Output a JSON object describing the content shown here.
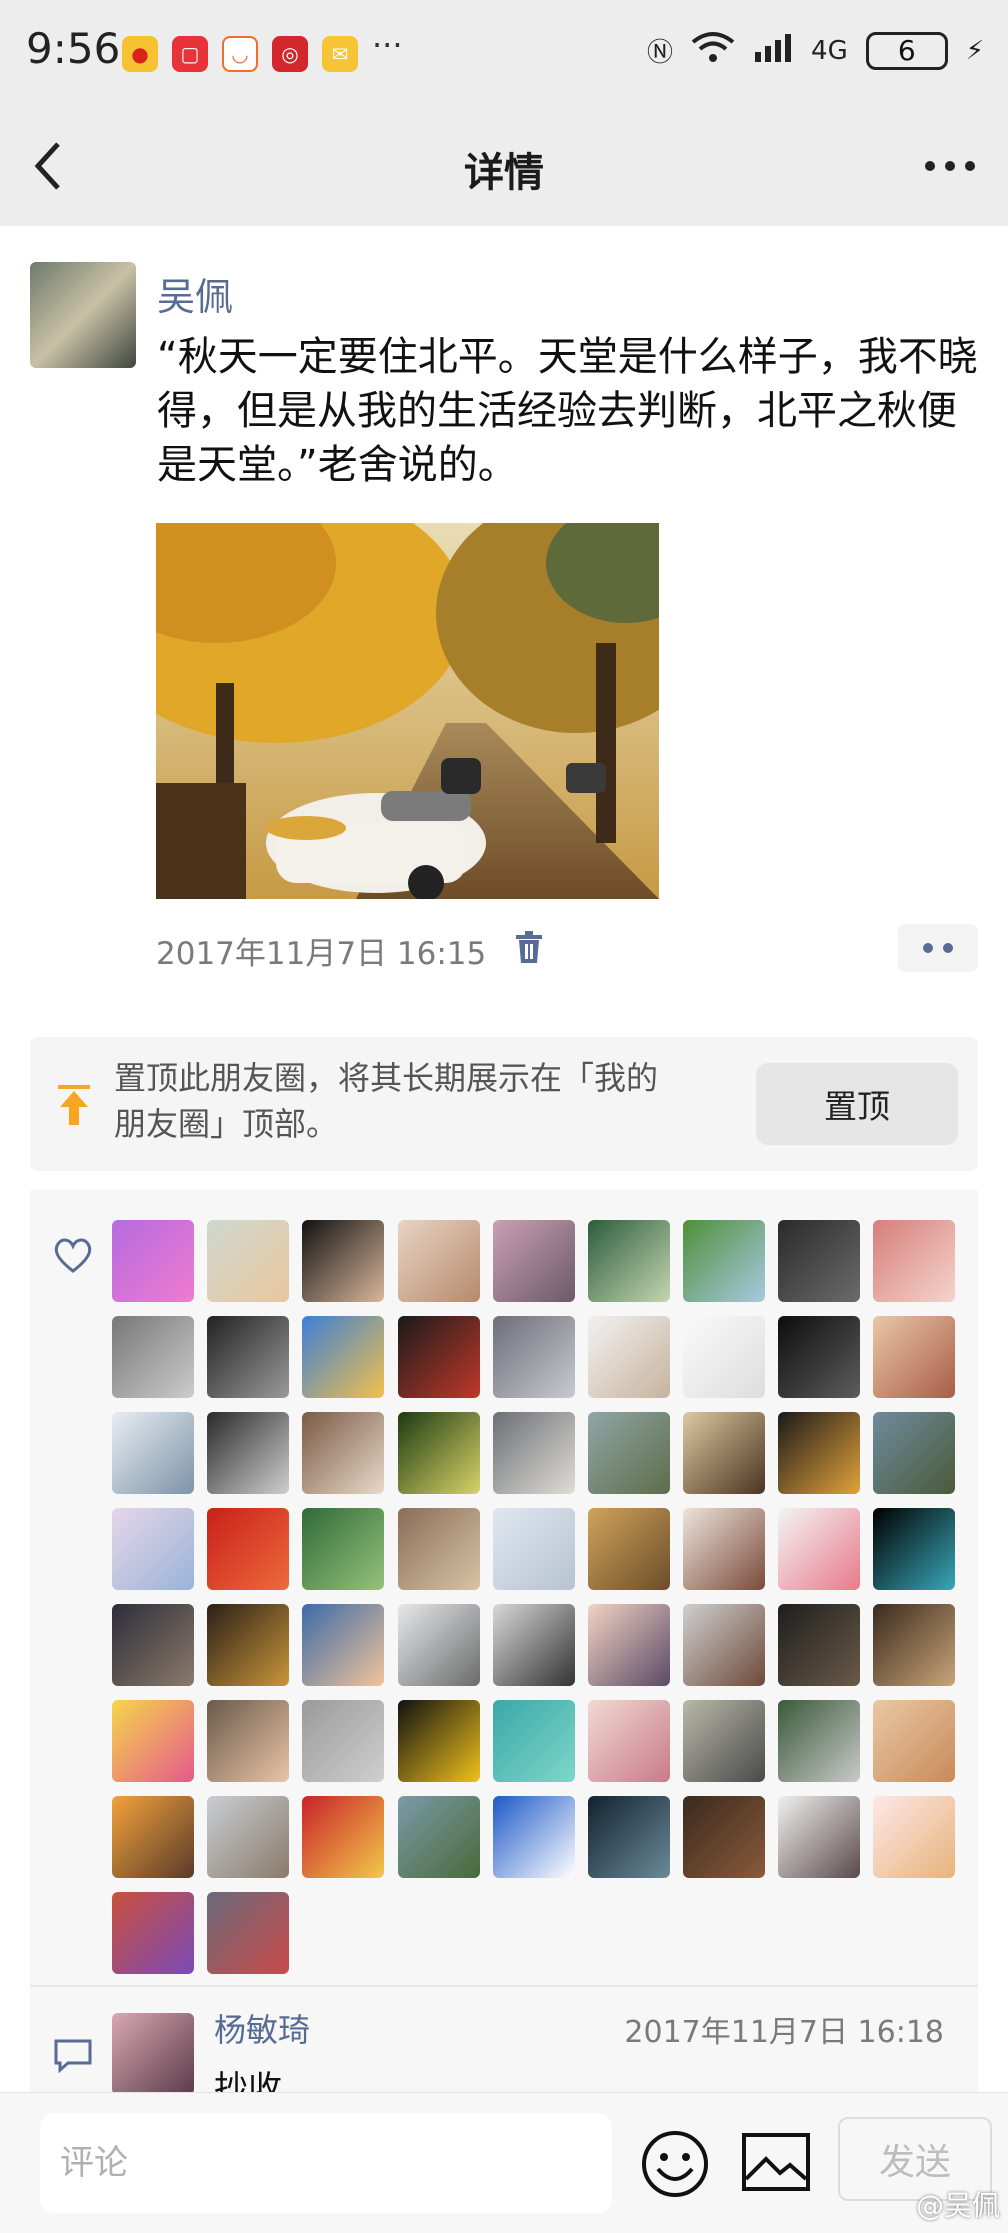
{
  "status_bar": {
    "time": "9:56",
    "more_notifications": "···",
    "network": "6",
    "signal_label": "4G",
    "battery": "6"
  },
  "header": {
    "title": "详情"
  },
  "post": {
    "author": "吴佩",
    "text": "“秋天一定要住北平。天堂是什么样子，我不晓得，但是从我的生活经验去判断，北平之秋便是天堂。”老舍说的。",
    "timestamp": "2017年11月7日 16:15"
  },
  "pin": {
    "text": "置顶此朋友圈，将其长期展示在「我的朋友圈」顶部。",
    "button_label": "置顶"
  },
  "likes": {
    "count_shown": 65
  },
  "comment": {
    "name": "杨敏琦",
    "time": "2017年11月7日 16:18",
    "text": "抄收."
  },
  "composer": {
    "placeholder": "评论",
    "send_label": "发送"
  },
  "watermark": "@吴佩",
  "colors": {
    "link": "#576b95",
    "accent": "#f6a623"
  }
}
